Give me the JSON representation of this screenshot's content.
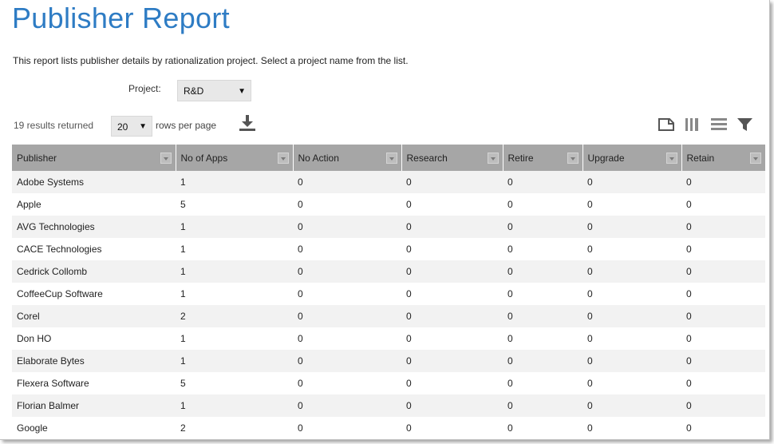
{
  "page": {
    "title": "Publisher Report",
    "description": "This report lists publisher details by rationalization project. Select a project name from the list.",
    "project_label": "Project:",
    "project_value": "R&D",
    "results_text": "19 results returned",
    "rows_per_page_value": "20",
    "rows_per_page_label": "rows per page",
    "accent_color": "#2e7cc4"
  },
  "toolbar": {
    "icons": [
      "download-icon",
      "export-icon",
      "columns-icon",
      "density-icon",
      "filter-icon"
    ]
  },
  "table": {
    "columns": [
      "Publisher",
      "No of Apps",
      "No Action",
      "Research",
      "Retire",
      "Upgrade",
      "Retain"
    ],
    "rows": [
      [
        "Adobe Systems",
        "1",
        "0",
        "0",
        "0",
        "0",
        "0"
      ],
      [
        "Apple",
        "5",
        "0",
        "0",
        "0",
        "0",
        "0"
      ],
      [
        "AVG Technologies",
        "1",
        "0",
        "0",
        "0",
        "0",
        "0"
      ],
      [
        "CACE Technologies",
        "1",
        "0",
        "0",
        "0",
        "0",
        "0"
      ],
      [
        "Cedrick Collomb",
        "1",
        "0",
        "0",
        "0",
        "0",
        "0"
      ],
      [
        "CoffeeCup Software",
        "1",
        "0",
        "0",
        "0",
        "0",
        "0"
      ],
      [
        "Corel",
        "2",
        "0",
        "0",
        "0",
        "0",
        "0"
      ],
      [
        "Don HO",
        "1",
        "0",
        "0",
        "0",
        "0",
        "0"
      ],
      [
        "Elaborate Bytes",
        "1",
        "0",
        "0",
        "0",
        "0",
        "0"
      ],
      [
        "Flexera Software",
        "5",
        "0",
        "0",
        "0",
        "0",
        "0"
      ],
      [
        "Florian Balmer",
        "1",
        "0",
        "0",
        "0",
        "0",
        "0"
      ],
      [
        "Google",
        "2",
        "0",
        "0",
        "0",
        "0",
        "0"
      ]
    ]
  }
}
